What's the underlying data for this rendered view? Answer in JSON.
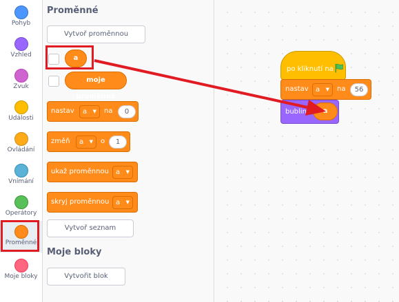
{
  "categories": [
    {
      "label": "Pohyb",
      "color": "#4c97ff"
    },
    {
      "label": "Vzhled",
      "color": "#9966ff"
    },
    {
      "label": "Zvuk",
      "color": "#cf63cf"
    },
    {
      "label": "Události",
      "color": "#ffbf00"
    },
    {
      "label": "Ovládání",
      "color": "#ffab19"
    },
    {
      "label": "Vnímání",
      "color": "#5cb1d6"
    },
    {
      "label": "Operátory",
      "color": "#59c059"
    },
    {
      "label": "Proměnné",
      "color": "#ff8c1a",
      "selected": true
    },
    {
      "label": "Moje bloky",
      "color": "#ff6680"
    }
  ],
  "palette": {
    "section_variables": "Proměnné",
    "make_variable": "Vytvoř proměnnou",
    "var_a": "a",
    "var_moje": "moje proměnná",
    "set_block": {
      "label": "nastav",
      "var": "a",
      "to": "na",
      "value": "0"
    },
    "change_block": {
      "label": "změň",
      "var": "a",
      "by": "o",
      "value": "1"
    },
    "show_block": {
      "label": "ukaž proměnnou",
      "var": "a"
    },
    "hide_block": {
      "label": "skryj proměnnou",
      "var": "a"
    },
    "make_list": "Vytvoř seznam",
    "section_myblocks": "Moje bloky",
    "make_block": "Vytvořit blok"
  },
  "script": {
    "hat_label": "po kliknutí na",
    "set_label": "nastav",
    "set_var": "a",
    "set_to": "na",
    "set_value": "56",
    "say_label": "bublina",
    "say_var": "a"
  },
  "colors": {
    "highlight": "#e11b22",
    "variables": "#ff8c1a",
    "looks": "#9966ff",
    "events": "#ffbf00"
  }
}
